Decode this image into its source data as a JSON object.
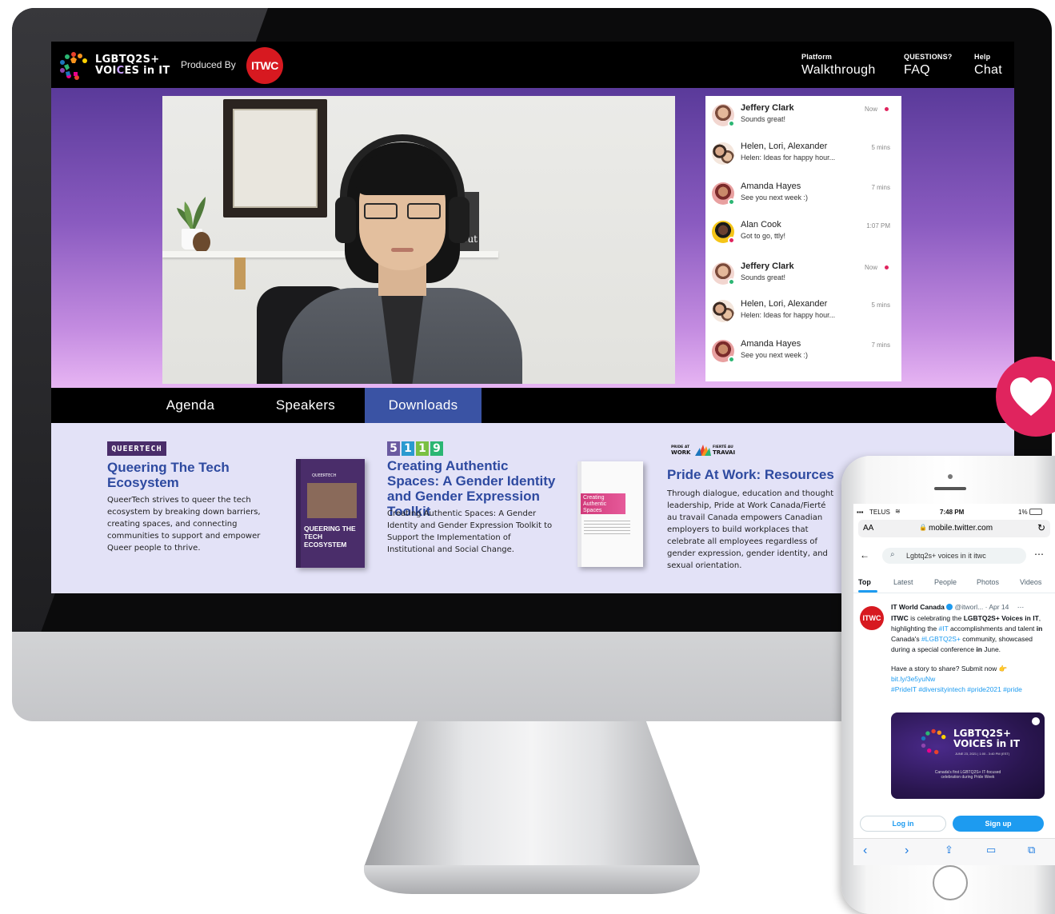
{
  "brand": {
    "logo_line1": "LGBTQ2S+",
    "logo_line2_a": "VOI",
    "logo_line2_b": "C",
    "logo_line2_c": "ES in IT",
    "produced_by": "Produced By",
    "producer_badge": "ITWC"
  },
  "nav": [
    {
      "small": "Platform",
      "big": "Walkthrough"
    },
    {
      "small": "QUESTIONS?",
      "big": "FAQ"
    },
    {
      "small": "Help",
      "big": "Chat"
    }
  ],
  "chat": [
    {
      "name": "Jeffery Clark",
      "preview": "Sounds great!",
      "time": "Now",
      "unread": true,
      "bold": true
    },
    {
      "name": "Helen, Lori, Alexander",
      "preview": "Helen: Ideas for happy hour...",
      "time": "5 mins",
      "unread": false,
      "bold": false
    },
    {
      "name": "Amanda Hayes",
      "preview": "See you next week :)",
      "time": "7 mins",
      "unread": false,
      "bold": false
    },
    {
      "name": "Alan Cook",
      "preview": "Got to go, ttly!",
      "time": "1:07 PM",
      "unread": false,
      "bold": false
    },
    {
      "name": "Jeffery Clark",
      "preview": "Sounds great!",
      "time": "Now",
      "unread": true,
      "bold": true
    },
    {
      "name": "Helen, Lori, Alexander",
      "preview": "Helen: Ideas for happy hour...",
      "time": "5 mins",
      "unread": false,
      "bold": false
    },
    {
      "name": "Amanda Hayes",
      "preview": "See you next week :)",
      "time": "7 mins",
      "unread": false,
      "bold": false
    }
  ],
  "tabs": [
    "Agenda",
    "Speakers",
    "Downloads"
  ],
  "active_tab": "Downloads",
  "downloads": [
    {
      "logo": "QUEERTECH",
      "title": "Queering The Tech Ecosystem",
      "description": "QueerTech strives to queer the tech ecosystem by breaking down barriers, creating spaces, and connecting communities to support and empower Queer people to thrive.",
      "cover_text": "QUEERING THE TECH ECOSYSTEM",
      "cover_brand": "QUEERTECH"
    },
    {
      "logo": [
        "5",
        "1",
        "1",
        "9"
      ],
      "title": "Creating Authentic Spaces: A Gender Identity and Gender Expression Toolkit",
      "description": "Creating Authentic Spaces: A Gender Identity and Gender Expression Toolkit to Support the Implementation of Institutional and Social Change.",
      "cover_text": "Creating Authentic Spaces"
    },
    {
      "logo_left": "PRIDE AT WORK CANADA",
      "logo_right": "FIERTÉ AU TRAVAIL CANADA",
      "title": "Pride At Work: Resources",
      "description": "Through dialogue, education and thought leadership, Pride at Work Canada/Fierté au travail Canada empowers Canadian employers to build workplaces that celebrate all employees regardless of gender expression, gender identity, and sexual orientation."
    }
  ],
  "phone": {
    "carrier": "TELUS",
    "time": "7:48 PM",
    "battery": "1%",
    "text_size": "AA",
    "url": "mobile.twitter.com",
    "search": "Lgbtq2s+ voices in it itwc",
    "tabs": [
      "Top",
      "Latest",
      "People",
      "Photos",
      "Videos"
    ],
    "tweet": {
      "avatar": "ITWC",
      "author": "IT World Canada",
      "handle": "@itworl...",
      "date": "· Apr 14",
      "p1_pre": "ITWC",
      "p1_a": " is celebrating the ",
      "p1_b": "LGBTQ2S+ Voices in IT",
      "p1_c": ", highlighting the ",
      "p1_d": "#IT",
      "p1_e": " accomplishments and talent ",
      "p1_f": "in",
      "p1_g": " Canada's ",
      "p1_h": "#LGBTQ2S+",
      "p1_i": " community, showcased during a special conference ",
      "p1_j": "in",
      "p1_k": " June.",
      "p2": "Have a story to share? Submit now 👉",
      "link": "bit.ly/3e5yuNw",
      "hashtags": "#PrideIT #diversityintech #pride2021 #pride",
      "media_title_1": "LGBTQ2S+",
      "media_title_2": "VOICES in IT",
      "media_date": "JUNE 23, 2021 | 1:00 - 3:40 PM (EST)",
      "media_caption": "Canada's first LGBTQ2S+ IT-focused celebration during Pride Week"
    },
    "login": "Log in",
    "signup": "Sign up"
  },
  "colors": {
    "accent_blue": "#2e4aa0",
    "tab_active": "#3a53a4",
    "itwc_red": "#d71920",
    "heart_pink": "#e0245e",
    "twitter_blue": "#1d9bf0"
  }
}
